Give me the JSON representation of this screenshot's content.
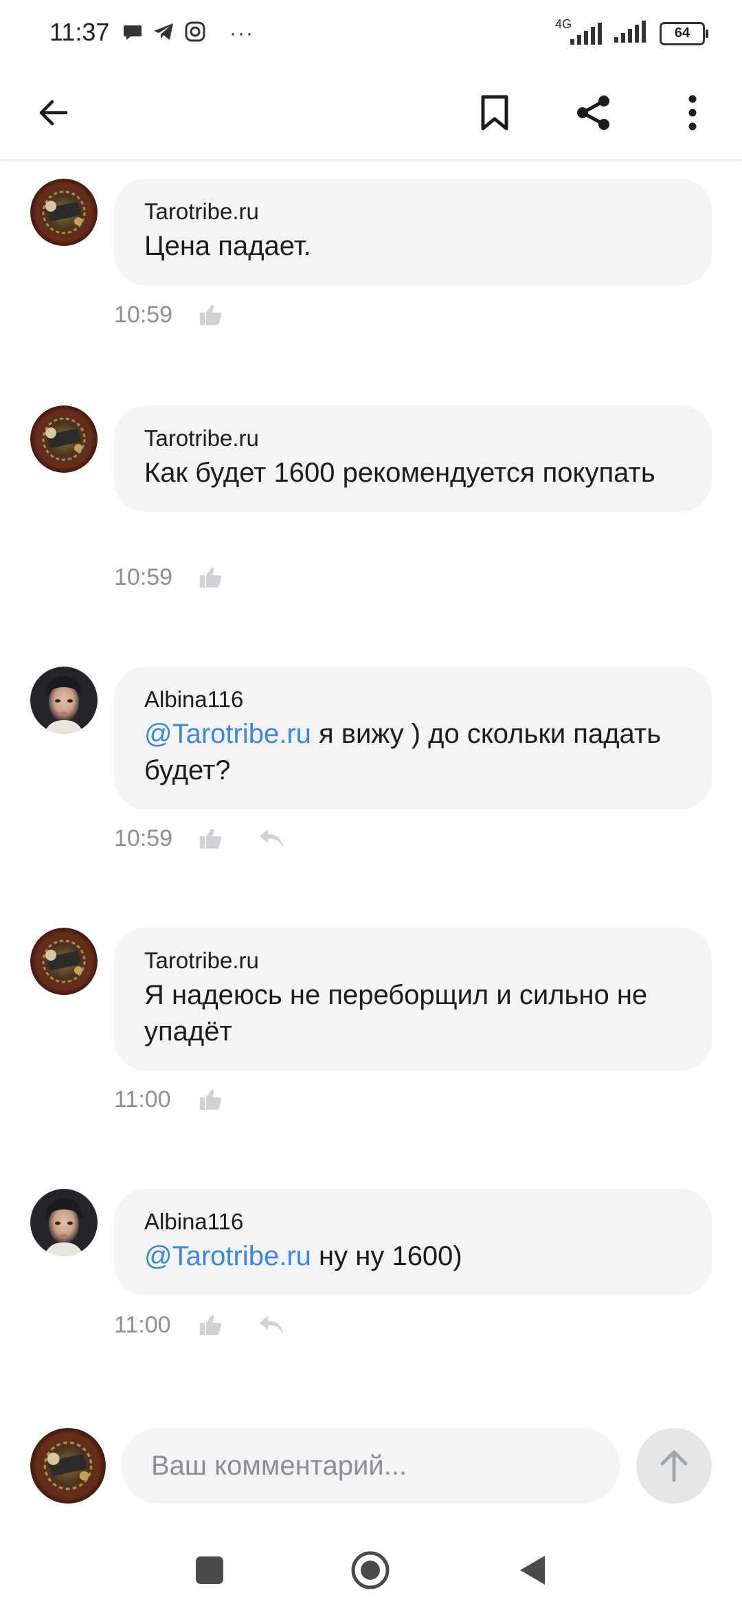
{
  "status_bar": {
    "time": "11:37",
    "network": "4G",
    "battery": "64",
    "more": "···"
  },
  "app_bar": {
    "back_icon": "arrow-left-icon",
    "bookmark_icon": "bookmark-icon",
    "share_icon": "share-icon",
    "menu_icon": "more-vertical-icon"
  },
  "comments": [
    {
      "author": "Tarotribe.ru",
      "mention": "",
      "text": "Цена падает.",
      "time": "10:59",
      "avatar": "tarot-avatar",
      "has_reply": false
    },
    {
      "author": "Tarotribe.ru",
      "mention": "",
      "text": "Как будет 1600 рекомендуется покупать",
      "time": "10:59",
      "avatar": "tarot-avatar",
      "has_reply": false
    },
    {
      "author": "Albina116",
      "mention": "@Tarotribe.ru",
      "text": " я вижу ) до скольки падать будет?",
      "time": "10:59",
      "avatar": "woman-avatar",
      "has_reply": true
    },
    {
      "author": "Tarotribe.ru",
      "mention": "",
      "text": "Я надеюсь не переборщил и сильно не упадёт",
      "time": "11:00",
      "avatar": "tarot-avatar",
      "has_reply": false
    },
    {
      "author": "Albina116",
      "mention": "@Tarotribe.ru",
      "text": " ну ну 1600)",
      "time": "11:00",
      "avatar": "woman-avatar",
      "has_reply": true
    }
  ],
  "composer": {
    "placeholder": "Ваш комментарий...",
    "value": ""
  },
  "colors": {
    "mention": "#3f86d6",
    "bubble": "#f3f4f6",
    "meta": "#8e8e93"
  }
}
